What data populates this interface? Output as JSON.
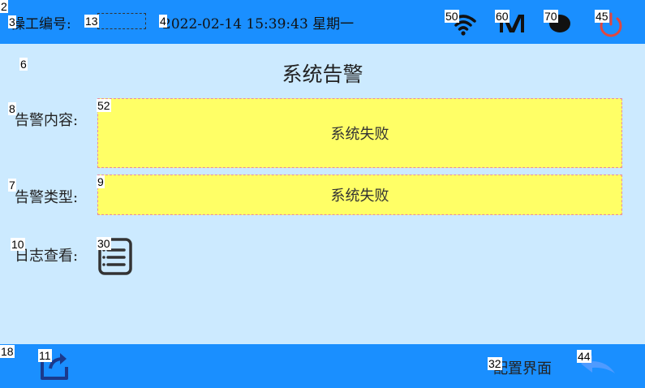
{
  "header": {
    "operator_label": "操工编号:",
    "datetime": "2022-02-14 15:39:43 星期一"
  },
  "page": {
    "title": "系统告警"
  },
  "form": {
    "content_label": "告警内容:",
    "content_value": "系统失败",
    "type_label": "告警类型:",
    "type_value": "系统失败",
    "log_label": "日志查看:"
  },
  "footer": {
    "settings_label": "配置界面"
  },
  "tags": {
    "t2": "2",
    "t3": "3",
    "t13": "13",
    "t4": "4",
    "t50": "50",
    "t60": "60",
    "t70": "70",
    "t45": "45",
    "t6": "6",
    "t8": "8",
    "t52": "52",
    "t7": "7",
    "t9": "9",
    "t10": "10",
    "t30": "30",
    "t18": "18",
    "t11": "11",
    "t32": "32",
    "t44": "44"
  },
  "icons": {
    "wifi": "wifi-icon",
    "mode": "mode-m-icon",
    "status": "status-circle-icon",
    "power": "power-icon",
    "log": "log-list-icon",
    "export": "export-icon",
    "back": "back-arrow-icon"
  },
  "colors": {
    "bar": "#1a8fff",
    "background": "#cceaff",
    "field": "#ffff66",
    "power": "#e0473f"
  }
}
